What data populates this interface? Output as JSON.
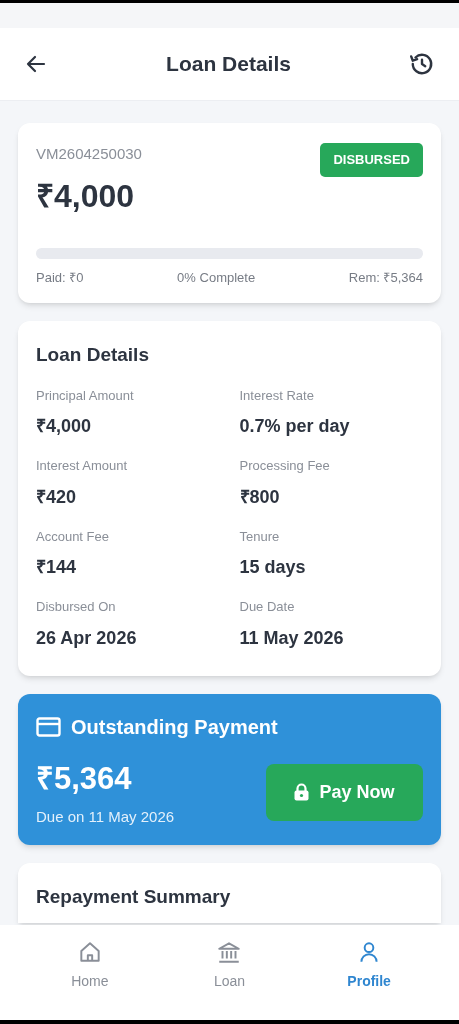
{
  "header": {
    "title": "Loan Details"
  },
  "loan_card": {
    "loan_id": "VM2604250030",
    "amount": "₹4,000",
    "status": "DISBURSED",
    "progress": {
      "level": 0
    },
    "paid": "Paid: ₹0",
    "complete": "0% Complete",
    "remaining": "Rem: ₹5,364"
  },
  "details": {
    "title": "Loan Details",
    "fields": [
      {
        "label": "Principal Amount",
        "value": "₹4,000"
      },
      {
        "label": "Interest Rate",
        "value": "0.7% per day"
      },
      {
        "label": "Interest Amount",
        "value": "₹420"
      },
      {
        "label": "Processing Fee",
        "value": "₹800"
      },
      {
        "label": "Account Fee",
        "value": "₹144"
      },
      {
        "label": "Tenure",
        "value": "15 days"
      },
      {
        "label": "Disbursed On",
        "value": "26 Apr 2026"
      },
      {
        "label": "Due Date",
        "value": "11 May 2026"
      }
    ]
  },
  "outstanding": {
    "title": "Outstanding Payment",
    "amount": "₹5,364",
    "due": "Due on 11 May 2026",
    "button": "Pay Now"
  },
  "repayment": {
    "title": "Repayment Summary"
  },
  "nav": [
    {
      "label": "Home",
      "selected": false
    },
    {
      "label": "Loan",
      "selected": false
    },
    {
      "label": "Profile",
      "selected": true
    }
  ]
}
